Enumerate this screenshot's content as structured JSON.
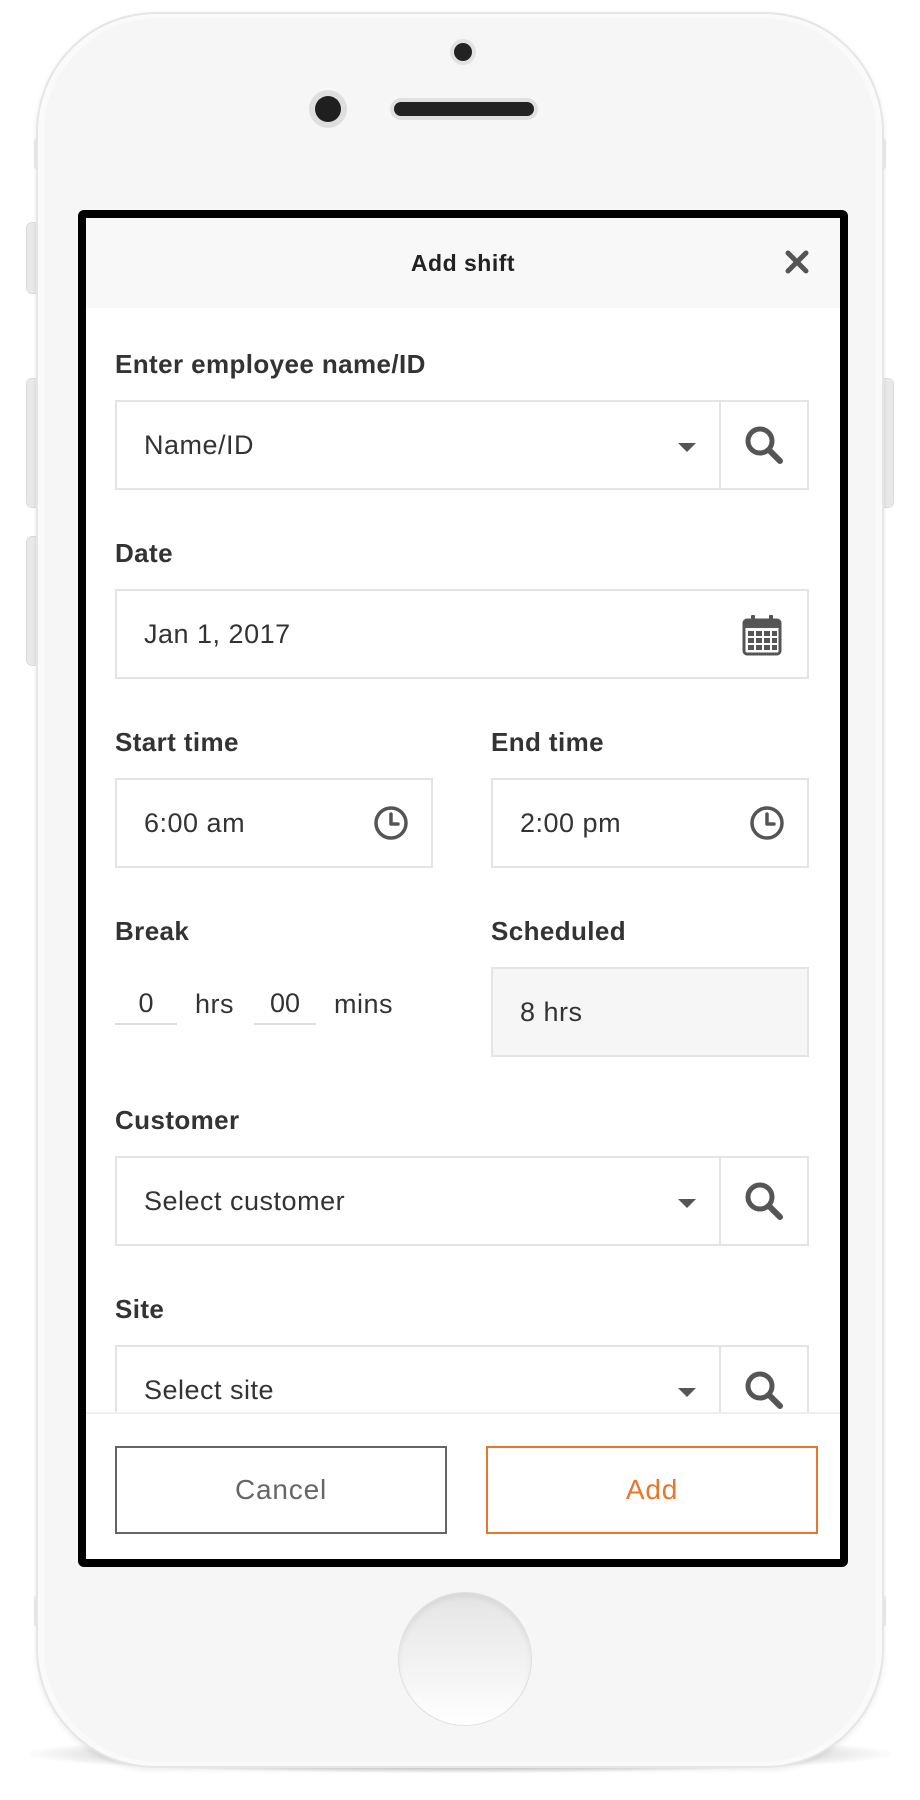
{
  "modal": {
    "title": "Add shift"
  },
  "employee": {
    "label": "Enter employee name/ID",
    "placeholder": "Name/ID"
  },
  "date": {
    "label": "Date",
    "value": "Jan 1, 2017"
  },
  "start_time": {
    "label": "Start time",
    "value": "6:00 am"
  },
  "end_time": {
    "label": "End time",
    "value": "2:00 pm"
  },
  "break": {
    "label": "Break",
    "hours_value": "0",
    "hours_unit": "hrs",
    "minutes_value": "00",
    "minutes_unit": "mins"
  },
  "scheduled": {
    "label": "Scheduled",
    "value": "8 hrs"
  },
  "customer": {
    "label": "Customer",
    "placeholder": "Select customer"
  },
  "site": {
    "label": "Site",
    "placeholder": "Select site"
  },
  "footer": {
    "cancel_label": "Cancel",
    "add_label": "Add"
  },
  "colors": {
    "accent": "#e8762c",
    "text": "#333333",
    "border": "#e4e4e4",
    "frame": "#000000"
  }
}
